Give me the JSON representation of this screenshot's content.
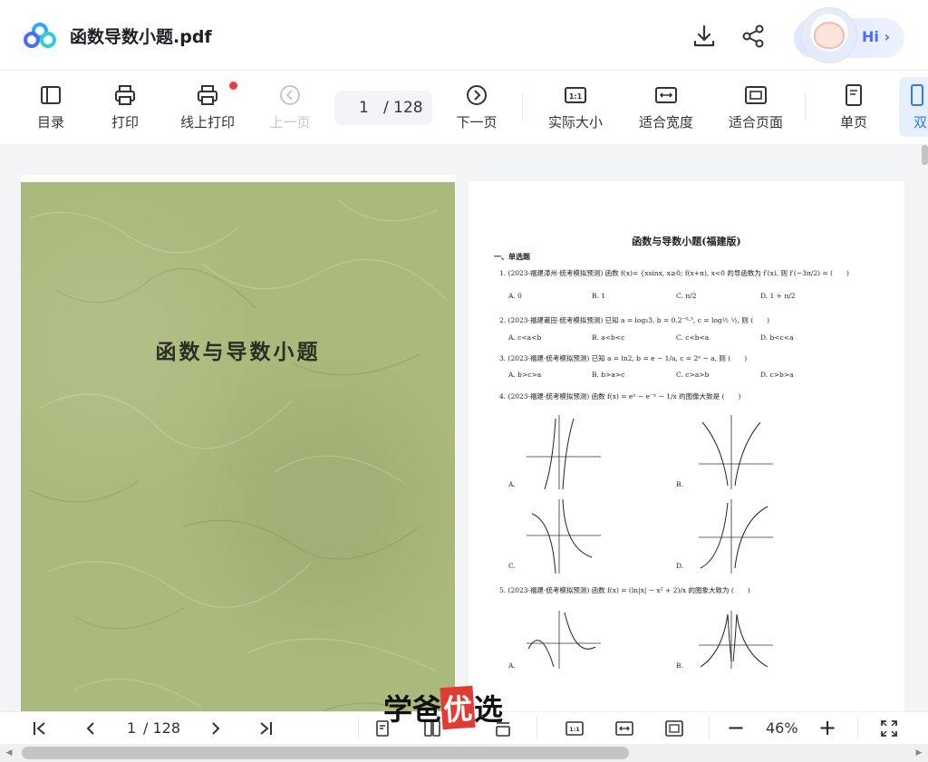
{
  "titlebar": {
    "title": "函数导数小题.pdf",
    "hi_label": "Hi ›",
    "icons": [
      "cloud-logo-icon",
      "download-icon",
      "share-icon"
    ]
  },
  "toolbar": {
    "items": [
      {
        "label": "目录",
        "icon": "toc-icon"
      },
      {
        "label": "打印",
        "icon": "print-icon"
      },
      {
        "label": "线上打印",
        "icon": "online-print-icon"
      },
      {
        "label": "上一页",
        "icon": "prev-page-icon",
        "disabled": true
      },
      {
        "label": "下一页",
        "icon": "next-page-icon"
      },
      {
        "label": "实际大小",
        "icon": "actual-size-icon"
      },
      {
        "label": "适合宽度",
        "icon": "fit-width-icon"
      },
      {
        "label": "适合页面",
        "icon": "fit-page-icon"
      },
      {
        "label": "单页",
        "icon": "single-page-icon"
      },
      {
        "label": "双",
        "icon": "double-page-icon"
      }
    ],
    "page_current": "1",
    "page_total": "/ 128",
    "notification_color": "#f2384b"
  },
  "document": {
    "cover_title": "函数与导数小题",
    "sheet_title": "函数与导数小题(福建版)",
    "section": "一、单选题",
    "questions": [
      {
        "text": "1. (2023·福建漳州·统考模拟预测) 函数 f(x)= {xsinx, x≥0; f(x+π), x<0 的导函数为 f′(x), 则 f′(−3π/2) = (　　)",
        "options": [
          "A. 0",
          "B. 1",
          "C. π/2",
          "D. 1 + π/2"
        ]
      },
      {
        "text": "2. (2023·福建莆田·统考模拟预测) 已知 a = log₂3, b = 0.2⁻⁰·³, c = log½ ½, 则 (　　)",
        "options": [
          "A. c<a<b",
          "B. a<b<c",
          "C. c<b<a",
          "D. b<c<a"
        ]
      },
      {
        "text": "3. (2023·福建·统考模拟预测) 已知 a = ln2, b = e − 1/a, c = 2ᵉ − a, 则 (　　)",
        "options": [
          "A. b>c>a",
          "B. b>a>c",
          "C. c>a>b",
          "D. c>b>a"
        ]
      },
      {
        "text": "4. (2023·福建·统考模拟预测) 函数 f(x) = eˣ − e⁻ˣ − 1/x 的图像大致是 (　　)",
        "options": [
          "A.",
          "B.",
          "C.",
          "D."
        ]
      },
      {
        "text": "5. (2023·福建·统考模拟预测) 函数 f(x) = (ln|x| − x² + 2)/x 的图象大致为 (　　)",
        "options": [
          "A.",
          "B."
        ]
      }
    ]
  },
  "bottombar": {
    "page_current": "1",
    "page_total": "/ 128",
    "zoom": "46%",
    "zoom_out": "−",
    "zoom_in": "+"
  },
  "watermark": {
    "part1": "学爸",
    "highlight": "优",
    "part2": "选",
    "highlight_color": "#e23a35"
  }
}
